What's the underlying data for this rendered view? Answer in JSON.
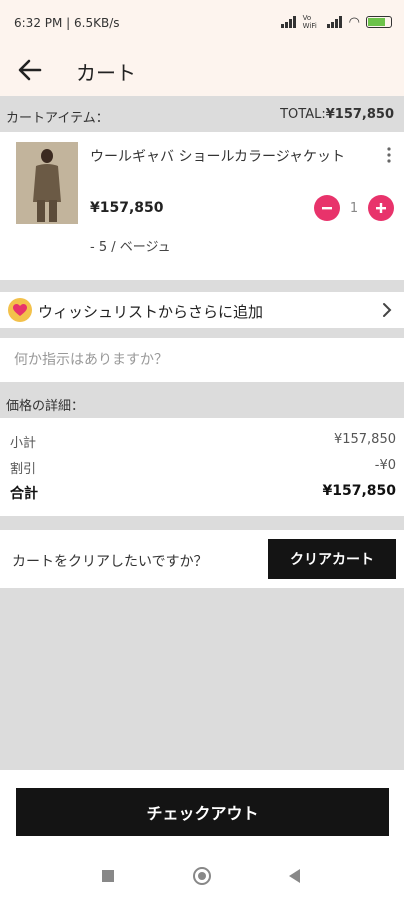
{
  "status_bar": {
    "time_speed": "6:32 PM | 6.5KB/s",
    "volte": "Vo WiFi",
    "battery": "100"
  },
  "header": {
    "back_icon": "arrow-left-icon",
    "title": "カート"
  },
  "cart": {
    "section_label": "カートアイテム：",
    "total_label": "TOTAL:",
    "total_value": "¥157,850",
    "items": [
      {
        "name": "ウールギャバ ショールカラージャケット",
        "price": "¥157,850",
        "quantity": "1",
        "variant": "- 5 / ベージュ"
      }
    ]
  },
  "wishlist": {
    "label": "ウィッシュリストからさらに追加",
    "icon": "heart-icon"
  },
  "note": {
    "placeholder": "何か指示はありますか？",
    "value": ""
  },
  "price_details": {
    "section_label": "価格の詳細：",
    "subtotal_label": "小計",
    "subtotal_value": "¥157,850",
    "discount_label": "割引",
    "discount_value": "-¥0",
    "total_label": "合計",
    "total_value": "¥157,850"
  },
  "clear_cart": {
    "question": "カートをクリアしたいですか？",
    "button_label": "クリアカート"
  },
  "checkout": {
    "button_label": "チェックアウト"
  },
  "colors": {
    "accent": "#e8336b",
    "header_bg": "#fdf4ee",
    "button_bg": "#141414"
  }
}
